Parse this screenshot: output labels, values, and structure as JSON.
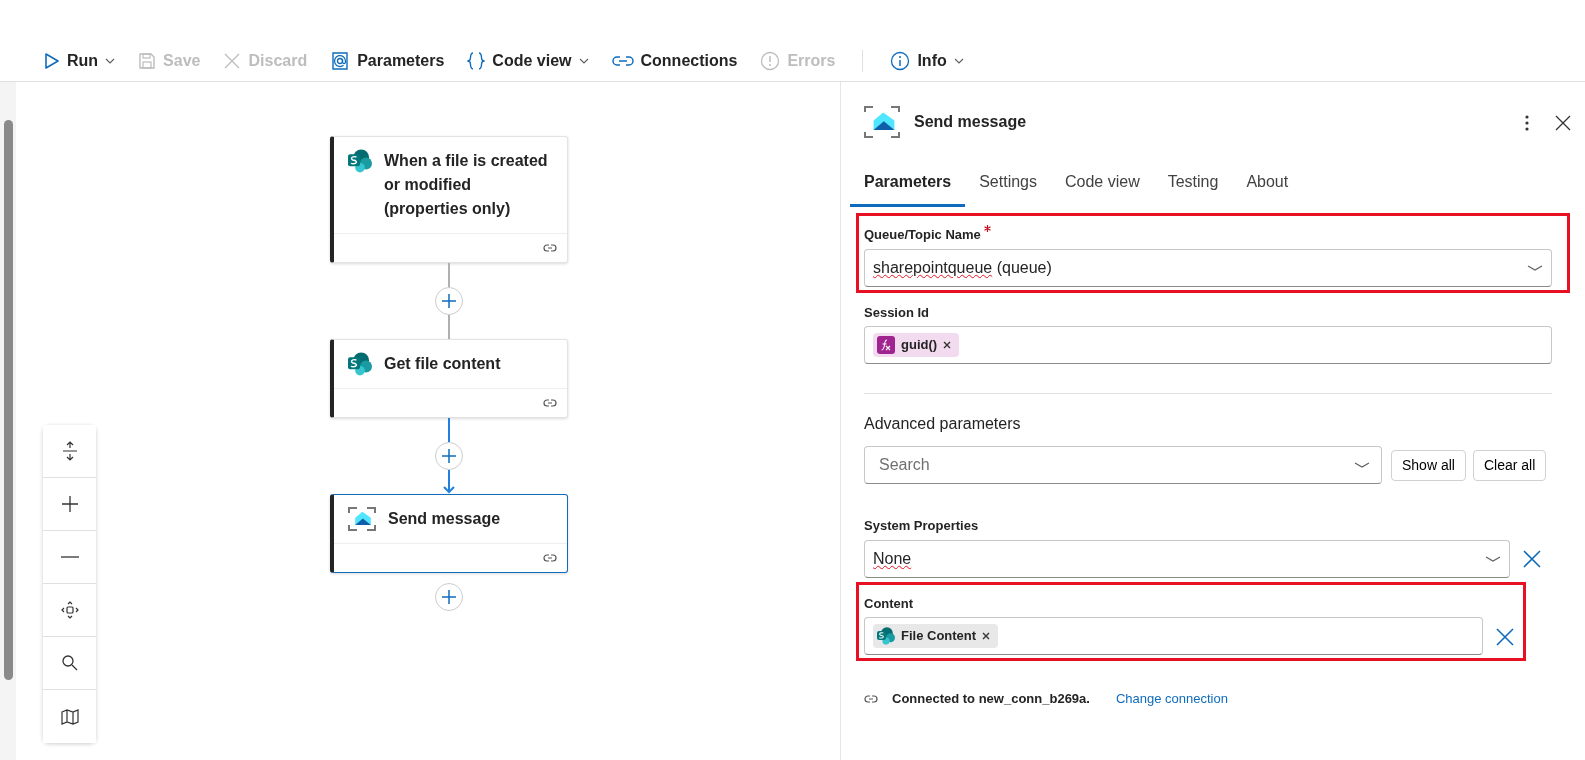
{
  "toolbar": {
    "groups": [
      [
        {
          "label": "Run",
          "kind": "run",
          "disabled": false,
          "caret": true
        },
        {
          "label": "Save",
          "kind": "save",
          "disabled": true,
          "caret": false
        },
        {
          "label": "Discard",
          "kind": "discard",
          "disabled": true,
          "caret": false
        },
        {
          "label": "Parameters",
          "kind": "parameters",
          "disabled": false,
          "caret": false
        },
        {
          "label": "Code view",
          "kind": "code",
          "disabled": false,
          "caret": true
        },
        {
          "label": "Connections",
          "kind": "connections",
          "disabled": false,
          "caret": false
        },
        {
          "label": "Errors",
          "kind": "errors",
          "disabled": true,
          "caret": false
        }
      ],
      [
        {
          "label": "Info",
          "kind": "info",
          "disabled": false,
          "caret": true
        }
      ]
    ]
  },
  "flow": {
    "nodes": [
      {
        "title": "When a file is created or modified (properties only)",
        "kind": "sharepoint",
        "selected": false
      },
      {
        "title": "Get file content",
        "kind": "sharepoint",
        "selected": false
      },
      {
        "title": "Send message",
        "kind": "servicebus",
        "selected": true
      }
    ]
  },
  "panel": {
    "title": "Send message",
    "kind": "servicebus",
    "tabs": [
      {
        "label": "Parameters",
        "selected": true
      },
      {
        "label": "Settings",
        "selected": false
      },
      {
        "label": "Code view",
        "selected": false
      },
      {
        "label": "Testing",
        "selected": false
      },
      {
        "label": "About",
        "selected": false
      }
    ],
    "fields": [
      {
        "kind": "dropdown",
        "label": "Queue/Topic Name",
        "required": true,
        "value": "sharepointqueue (queue)",
        "highlighted": true,
        "removable": false
      },
      {
        "kind": "token",
        "label": "Session Id",
        "token": {
          "text": "guid()",
          "kind": "function"
        },
        "highlighted": false,
        "removable": false
      }
    ],
    "advanced": {
      "title": "Advanced parameters",
      "search": {
        "placeholder": "Search"
      },
      "buttons": [
        "Show all",
        "Clear all"
      ],
      "fields": [
        {
          "kind": "dropdown",
          "label": "System Properties",
          "required": false,
          "value": "None",
          "highlighted": false,
          "removable": true
        },
        {
          "kind": "token",
          "label": "Content",
          "token": {
            "text": "File Content",
            "kind": "sharepoint"
          },
          "highlighted": true,
          "removable": true
        }
      ]
    },
    "connection": {
      "text": "Connected to new_conn_b269a.",
      "link": "Change connection"
    }
  }
}
